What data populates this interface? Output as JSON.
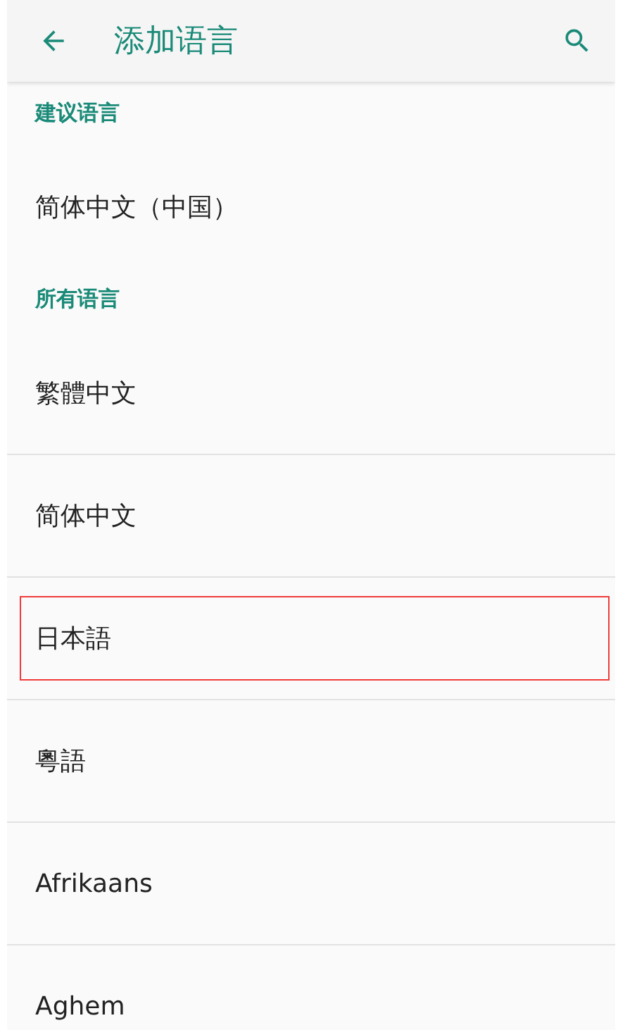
{
  "app_bar": {
    "title": "添加语言"
  },
  "sections": [
    {
      "header": "建议语言",
      "items": [
        {
          "label": "简体中文（中国）",
          "highlighted": false
        }
      ]
    },
    {
      "header": "所有语言",
      "items": [
        {
          "label": "繁體中文",
          "highlighted": false
        },
        {
          "label": "简体中文",
          "highlighted": false
        },
        {
          "label": "日本語",
          "highlighted": true
        },
        {
          "label": "粵語",
          "highlighted": false
        },
        {
          "label": "Afrikaans",
          "highlighted": false
        },
        {
          "label": "Aghem",
          "highlighted": false
        }
      ]
    }
  ]
}
